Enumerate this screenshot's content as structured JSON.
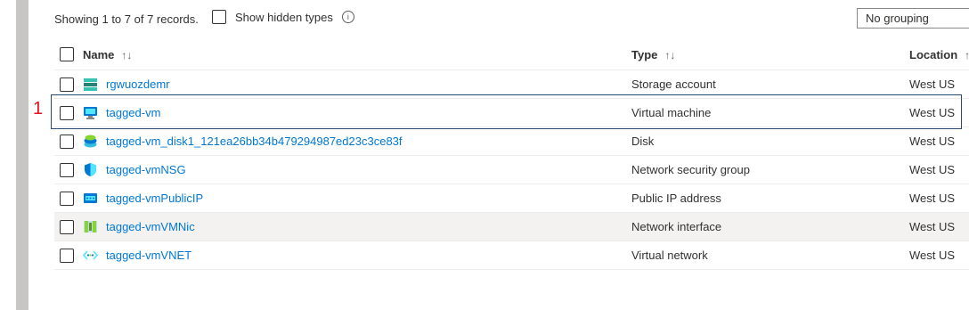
{
  "summary": "Showing 1 to 7 of 7 records.",
  "show_hidden_label": "Show hidden types",
  "grouping_value": "No grouping",
  "marker": "1",
  "columns": {
    "name": "Name",
    "type": "Type",
    "location": "Location"
  },
  "rows": [
    {
      "name": "rgwuozdemr",
      "type": "Storage account",
      "location": "West US",
      "icon": "storage-account-icon"
    },
    {
      "name": "tagged-vm",
      "type": "Virtual machine",
      "location": "West US",
      "icon": "virtual-machine-icon"
    },
    {
      "name": "tagged-vm_disk1_121ea26bb34b479294987ed23c3ce83f",
      "type": "Disk",
      "location": "West US",
      "icon": "disk-icon"
    },
    {
      "name": "tagged-vmNSG",
      "type": "Network security group",
      "location": "West US",
      "icon": "shield-icon"
    },
    {
      "name": "tagged-vmPublicIP",
      "type": "Public IP address",
      "location": "West US",
      "icon": "public-ip-icon"
    },
    {
      "name": "tagged-vmVMNic",
      "type": "Network interface",
      "location": "West US",
      "icon": "network-interface-icon"
    },
    {
      "name": "tagged-vmVNET",
      "type": "Virtual network",
      "location": "West US",
      "icon": "virtual-network-icon"
    }
  ]
}
